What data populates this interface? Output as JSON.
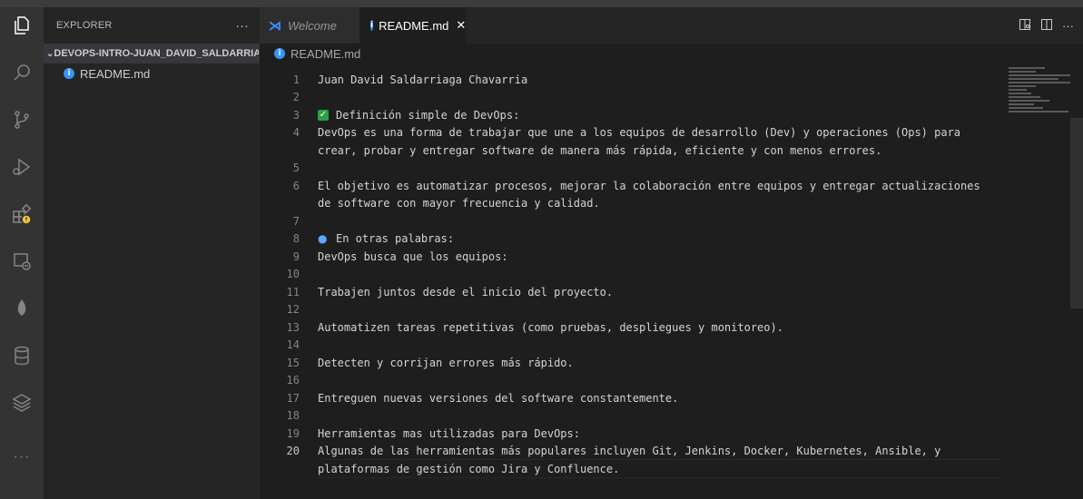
{
  "activity_bar": {
    "icons": [
      "explorer-icon",
      "search-icon",
      "source-control-icon",
      "run-debug-icon",
      "extensions-icon",
      "remote-explorer-icon",
      "mongodb-icon",
      "database-icon",
      "layers-icon",
      "more-icon"
    ],
    "more_label": "···",
    "warning_color": "#f0c93a"
  },
  "sidebar": {
    "title": "EXPLORER",
    "more_label": "···",
    "folder": "DEVOPS-INTRO-JUAN_DAVID_SALDARRIAG...",
    "files": [
      "README.md"
    ]
  },
  "tabs": [
    {
      "label": "Welcome",
      "icon": "vscode-logo-icon"
    },
    {
      "label": "README.md",
      "icon": "info-icon",
      "close": "✕"
    }
  ],
  "breadcrumb": "README.md",
  "editor": {
    "active_line": 20,
    "lines": [
      {
        "n": "1",
        "text": "Juan David Saldarriaga Chavarria"
      },
      {
        "n": "2",
        "text": ""
      },
      {
        "n": "3",
        "text": "Definición simple de DevOps:",
        "emoji": "check"
      },
      {
        "n": "4",
        "text": "DevOps es una forma de trabajar que une a los equipos de desarrollo (Dev) y operaciones (Ops) para"
      },
      {
        "n": "",
        "text": "crear, probar y entregar software de manera más rápida, eficiente y con menos errores."
      },
      {
        "n": "5",
        "text": ""
      },
      {
        "n": "6",
        "text": "El objetivo es automatizar procesos, mejorar la colaboración entre equipos y entregar actualizaciones"
      },
      {
        "n": "",
        "text": "de software con mayor frecuencia y calidad."
      },
      {
        "n": "7",
        "text": ""
      },
      {
        "n": "8",
        "text": "En otras palabras:",
        "emoji": "search"
      },
      {
        "n": "9",
        "text": "DevOps busca que los equipos:"
      },
      {
        "n": "10",
        "text": ""
      },
      {
        "n": "11",
        "text": "Trabajen juntos desde el inicio del proyecto."
      },
      {
        "n": "12",
        "text": ""
      },
      {
        "n": "13",
        "text": "Automatizen tareas repetitivas (como pruebas, despliegues y monitoreo)."
      },
      {
        "n": "14",
        "text": ""
      },
      {
        "n": "15",
        "text": "Detecten y corrijan errores más rápido."
      },
      {
        "n": "16",
        "text": ""
      },
      {
        "n": "17",
        "text": "Entreguen nuevas versiones del software constantemente."
      },
      {
        "n": "18",
        "text": ""
      },
      {
        "n": "19",
        "text": "Herramientas mas utilizadas para DevOps:"
      },
      {
        "n": "20",
        "text": "Algunas de las herramientas más populares incluyen Git, Jenkins, Docker, Kubernetes, Ansible, y"
      },
      {
        "n": "",
        "text": "plataformas de gestión como Jira y Confluence."
      }
    ]
  }
}
